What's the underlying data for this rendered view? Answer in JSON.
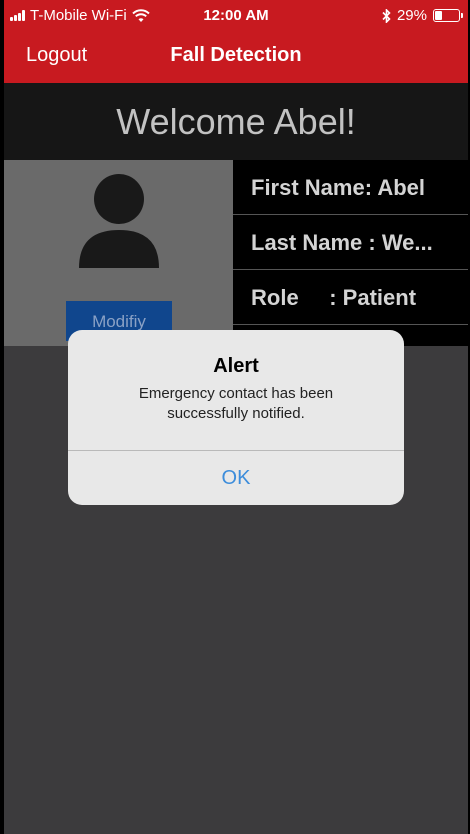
{
  "status_bar": {
    "carrier": "T-Mobile Wi-Fi",
    "time": "12:00 AM",
    "battery_text": "29%",
    "battery_level": 0.29,
    "wifi_icon": "wifi-icon",
    "bluetooth_icon": "bluetooth-icon"
  },
  "nav": {
    "logout_label": "Logout",
    "title": "Fall Detection"
  },
  "welcome": {
    "text": "Welcome Abel!"
  },
  "profile": {
    "avatar_icon": "user-avatar-icon",
    "modify_label": "Modifiy",
    "first_name": "First Name: Abel",
    "last_name": "Last Name : We...",
    "role": "Role     : Patient"
  },
  "alert": {
    "title": "Alert",
    "message": "Emergency contact has been successfully notified.",
    "ok_label": "OK"
  },
  "colors": {
    "header_red": "#c81a20",
    "modify_blue": "#10468d",
    "ok_blue": "#3d8ddb"
  }
}
